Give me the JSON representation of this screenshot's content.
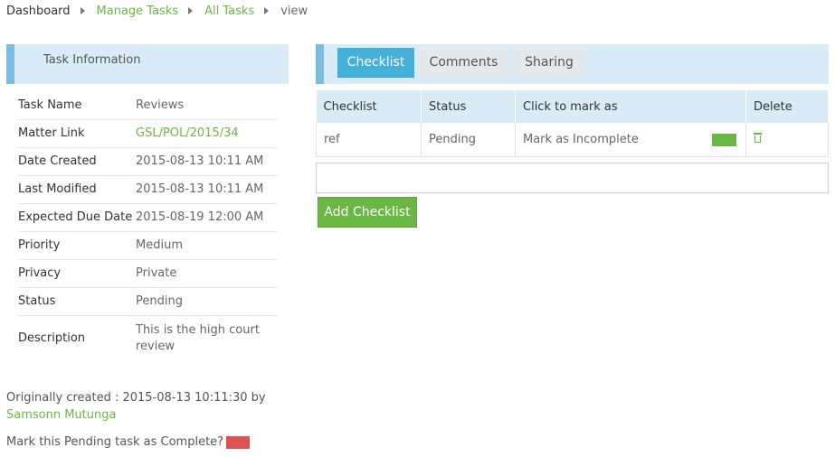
{
  "breadcrumb": {
    "items": [
      "Dashboard",
      "Manage Tasks",
      "All Tasks",
      "view"
    ]
  },
  "task_panel": {
    "title": "Task Information",
    "fields": [
      {
        "label": "Task Name",
        "value": "Reviews"
      },
      {
        "label": "Matter Link",
        "value": "GSL/POL/2015/34"
      },
      {
        "label": "Date Created",
        "value": "2015-08-13 10:11 AM"
      },
      {
        "label": "Last Modified",
        "value": "2015-08-13 10:11 AM"
      },
      {
        "label": "Expected Due Date",
        "value": "2015-08-19 12:00 AM"
      },
      {
        "label": "Priority",
        "value": "Medium"
      },
      {
        "label": "Privacy",
        "value": "Private"
      },
      {
        "label": "Status",
        "value": "Pending"
      },
      {
        "label": "Description",
        "value": "This is the high court review"
      }
    ],
    "originally_created_prefix": "Originally created : 2015-08-13 10:11:30 by",
    "created_by": "Samsonn Mutunga",
    "mark_complete_text": "Mark this Pending task as Complete?"
  },
  "tabs": [
    {
      "label": "Checklist",
      "active": true
    },
    {
      "label": "Comments",
      "active": false
    },
    {
      "label": "Sharing",
      "active": false
    }
  ],
  "checklist": {
    "headers": [
      "Checklist",
      "Status",
      "Click to mark as",
      "Delete"
    ],
    "rows": [
      {
        "item": "ref",
        "status": "Pending",
        "action": "Mark as Incomplete"
      }
    ],
    "input_value": "",
    "add_button": "Add Checklist"
  },
  "colors": {
    "accent_green": "#6ab744",
    "header_blue": "#d9ebf6",
    "tab_active": "#45b0d9",
    "danger_red": "#e05252"
  }
}
